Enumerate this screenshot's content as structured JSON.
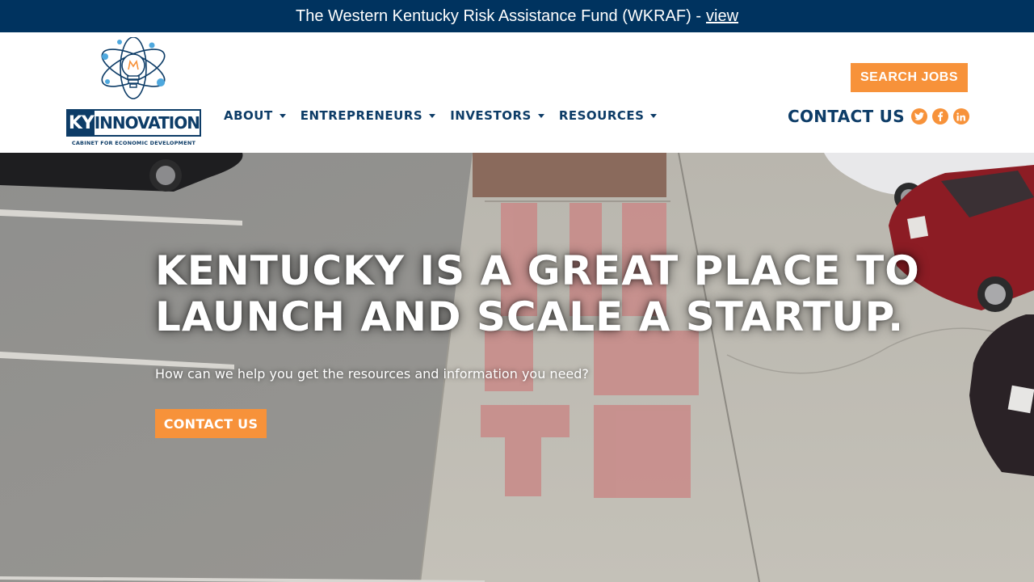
{
  "announcement": {
    "text": "The Western Kentucky Risk Assistance Fund (WKRAF) -",
    "link": "view"
  },
  "brand": {
    "logo_ky": "KY",
    "logo_name": "INNOVATION",
    "logo_tagline": "CABINET FOR ECONOMIC DEVELOPMENT",
    "accent": "#f7923a",
    "navy": "#00335f"
  },
  "nav": {
    "items": [
      {
        "label": "ABOUT"
      },
      {
        "label": "ENTREPRENEURS"
      },
      {
        "label": "INVESTORS"
      },
      {
        "label": "RESOURCES"
      }
    ]
  },
  "header": {
    "search_jobs": "SEARCH JOBS",
    "contact": "CONTACT US",
    "social": {
      "twitter": "twitter-icon",
      "facebook": "facebook-icon",
      "linkedin": "linkedin-icon"
    }
  },
  "hero": {
    "title": "KENTUCKY IS A GREAT PLACE TO LAUNCH AND SCALE A STARTUP.",
    "subtitle": "How can we help you get the resources and information you need?",
    "cta": "CONTACT US"
  }
}
